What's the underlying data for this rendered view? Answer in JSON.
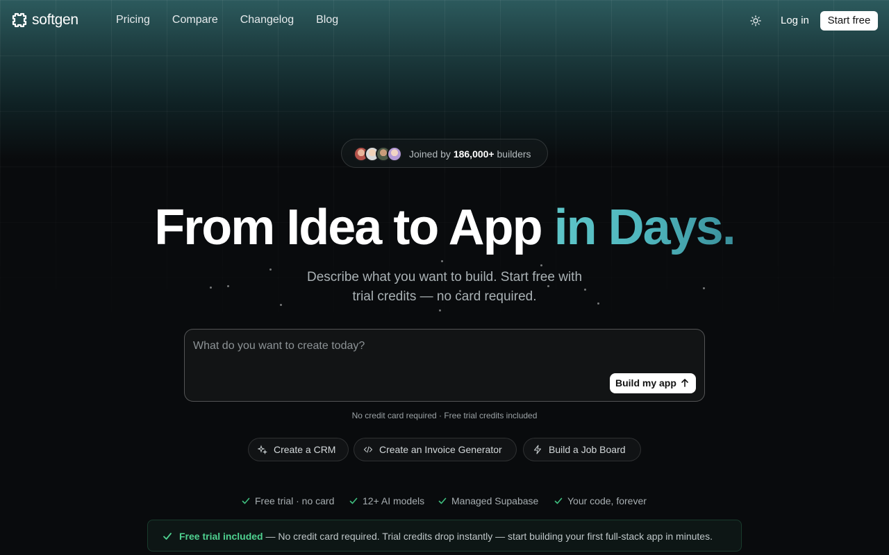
{
  "brand": {
    "name": "softgen"
  },
  "nav": {
    "links": [
      "Pricing",
      "Compare",
      "Changelog",
      "Blog"
    ],
    "theme_icon": "sun-icon",
    "login_label": "Log in",
    "start_label": "Start free"
  },
  "social_proof": {
    "prefix": "Joined by",
    "count": "186,000+",
    "suffix": "builders"
  },
  "hero": {
    "headline_main": "From Idea to App",
    "headline_accent": "in Days.",
    "subtitle": "Describe what you want to build. Start free with trial credits — no card required."
  },
  "prompt": {
    "placeholder": "What do you want to create today?",
    "value": "",
    "build_label": "Build my app",
    "note": "No credit card required · Free trial credits included"
  },
  "suggestions": [
    {
      "label": "Create a CRM",
      "icon": "sparkle-icon"
    },
    {
      "label": "Create an Invoice Generator",
      "icon": "code-icon"
    },
    {
      "label": "Build a Job Board",
      "icon": "lightning-icon"
    }
  ],
  "features": [
    "Free trial · no card",
    "12+ AI models",
    "Managed Supabase",
    "Your code, forever"
  ],
  "banner": {
    "strong": "Free trial included",
    "text": " — No credit card required. Trial credits drop instantly — start building your first full-stack app in minutes."
  },
  "colors": {
    "accent": "#4fb6bd",
    "success": "#4fd190",
    "background": "#090b0d"
  }
}
